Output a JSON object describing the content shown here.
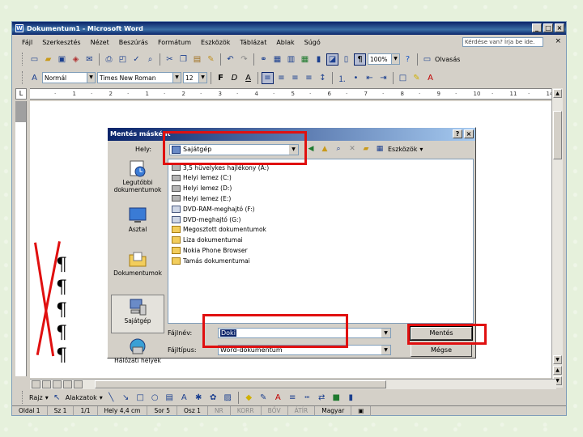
{
  "window": {
    "title": "Dokumentum1 - Microsoft Word"
  },
  "menu": {
    "items": [
      "Fájl",
      "Szerkesztés",
      "Nézet",
      "Beszúrás",
      "Formátum",
      "Eszközök",
      "Táblázat",
      "Ablak",
      "Súgó"
    ],
    "ask_placeholder": "Kérdése van? Írja be ide.",
    "close": "×"
  },
  "toolbar": {
    "zoom": "100%",
    "read_label": "Olvasás",
    "style": "Normál",
    "font": "Times New Roman",
    "size": "12"
  },
  "ruler": {
    "numbers": [
      "·",
      "1",
      "·",
      "2",
      "·",
      "1",
      "·",
      "2",
      "·",
      "3",
      "·",
      "4",
      "·",
      "5",
      "·",
      "6",
      "·",
      "7",
      "·",
      "8",
      "·",
      "9",
      "·",
      "10",
      "·",
      "11",
      "·",
      "14"
    ]
  },
  "document": {
    "pilcrow": "¶"
  },
  "dialog": {
    "title": "Mentés másként",
    "help": "?",
    "close": "×",
    "lookin_label": "Hely:",
    "lookin_value": "Sajátgép",
    "tools_label": "Eszközök",
    "places": [
      {
        "label": "Legutóbbi dokumentumok",
        "icon": "recent-documents-icon"
      },
      {
        "label": "Asztal",
        "icon": "desktop-icon"
      },
      {
        "label": "Dokumentumok",
        "icon": "my-documents-icon"
      },
      {
        "label": "Sajátgép",
        "icon": "my-computer-icon"
      },
      {
        "label": "Hálózati helyek",
        "icon": "network-places-icon"
      }
    ],
    "files": [
      {
        "name": "3,5 hüvelykes hajlékony (A:)",
        "type": "drive"
      },
      {
        "name": "Helyi lemez (C:)",
        "type": "drive"
      },
      {
        "name": "Helyi lemez (D:)",
        "type": "drive"
      },
      {
        "name": "Helyi lemez (E:)",
        "type": "drive"
      },
      {
        "name": "DVD-RAM-meghajtó (F:)",
        "type": "dvd"
      },
      {
        "name": "DVD-meghajtó (G:)",
        "type": "dvd"
      },
      {
        "name": "Megosztott dokumentumok",
        "type": "folder"
      },
      {
        "name": "Liza dokumentumai",
        "type": "folder"
      },
      {
        "name": "Nokia Phone Browser",
        "type": "folder"
      },
      {
        "name": "Tamás dokumentumai",
        "type": "folder"
      }
    ],
    "filename_label": "Fájlnév:",
    "filename_value": "Doki",
    "filetype_label": "Fájltípus:",
    "filetype_value": "Word-dokumentum",
    "save_button": "Mentés",
    "cancel_button": "Mégse"
  },
  "drawing": {
    "draw_label": "Rajz",
    "autoshapes_label": "Alakzatok"
  },
  "status": {
    "page": "Oldal 1",
    "section": "Sz 1",
    "pages": "1/1",
    "position": "Hely 4,4 cm",
    "line": "Sor 5",
    "column": "Osz 1",
    "rec": "NR",
    "trk": "KORR",
    "ext": "BŐV",
    "ovr": "ÁTÍR",
    "language": "Magyar"
  },
  "annotation_color": "#e01010"
}
